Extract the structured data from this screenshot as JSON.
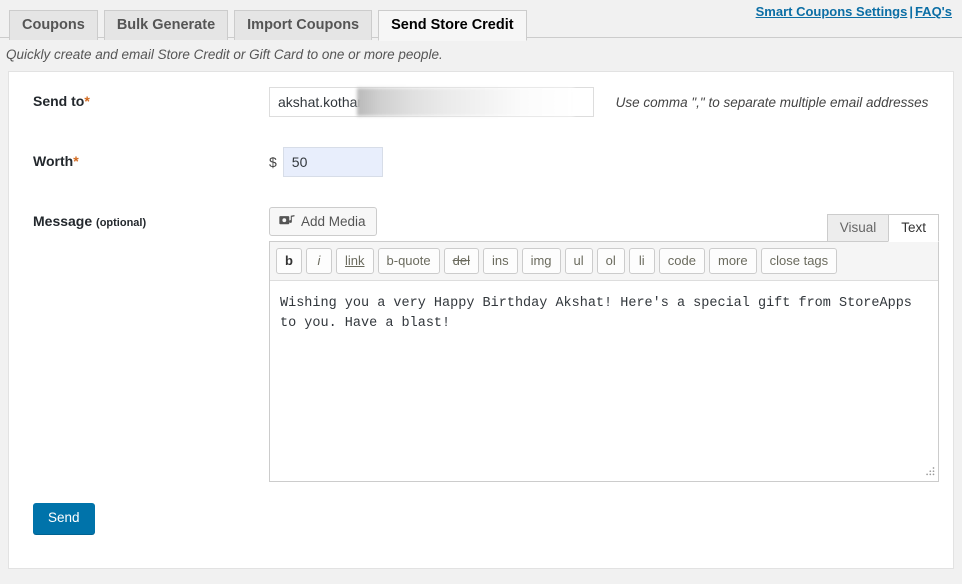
{
  "header": {
    "tabs": [
      {
        "label": "Coupons",
        "active": false
      },
      {
        "label": "Bulk Generate",
        "active": false
      },
      {
        "label": "Import Coupons",
        "active": false
      },
      {
        "label": "Send Store Credit",
        "active": true
      }
    ],
    "links": {
      "settings": "Smart Coupons Settings",
      "separator": "|",
      "faq": "FAQ's"
    },
    "link_color": "#0b6ea5"
  },
  "subtitle": "Quickly create and email Store Credit or Gift Card to one or more people.",
  "form": {
    "send_to": {
      "label": "Send to",
      "required_mark": "*",
      "value": "akshat.kothari",
      "placeholder": "",
      "hint": "Use comma \",\" to separate multiple email addresses"
    },
    "worth": {
      "label": "Worth",
      "required_mark": "*",
      "currency_symbol": "$",
      "value": "50",
      "placeholder": ""
    },
    "message": {
      "label": "Message",
      "optional_text": "(optional)",
      "add_media_label": "Add Media",
      "add_media_icon": "add-media-icon",
      "editor_tabs": [
        {
          "label": "Visual",
          "active": false
        },
        {
          "label": "Text",
          "active": true
        }
      ],
      "quicktags": [
        {
          "label": "b",
          "style": "b",
          "name": "bold"
        },
        {
          "label": "i",
          "style": "i",
          "name": "italic"
        },
        {
          "label": "link",
          "style": "u",
          "name": "link"
        },
        {
          "label": "b-quote",
          "style": "",
          "name": "blockquote"
        },
        {
          "label": "del",
          "style": "s",
          "name": "del"
        },
        {
          "label": "ins",
          "style": "",
          "name": "ins"
        },
        {
          "label": "img",
          "style": "",
          "name": "img"
        },
        {
          "label": "ul",
          "style": "",
          "name": "ul"
        },
        {
          "label": "ol",
          "style": "",
          "name": "ol"
        },
        {
          "label": "li",
          "style": "",
          "name": "li"
        },
        {
          "label": "code",
          "style": "",
          "name": "code"
        },
        {
          "label": "more",
          "style": "",
          "name": "more"
        },
        {
          "label": "close tags",
          "style": "",
          "name": "close-tags"
        }
      ],
      "content": "Wishing you a very Happy Birthday Akshat! Here's a special gift from StoreApps to you. Have a blast!",
      "placeholder": ""
    }
  },
  "submit": {
    "send_label": "Send",
    "button_color": "#0073aa"
  }
}
